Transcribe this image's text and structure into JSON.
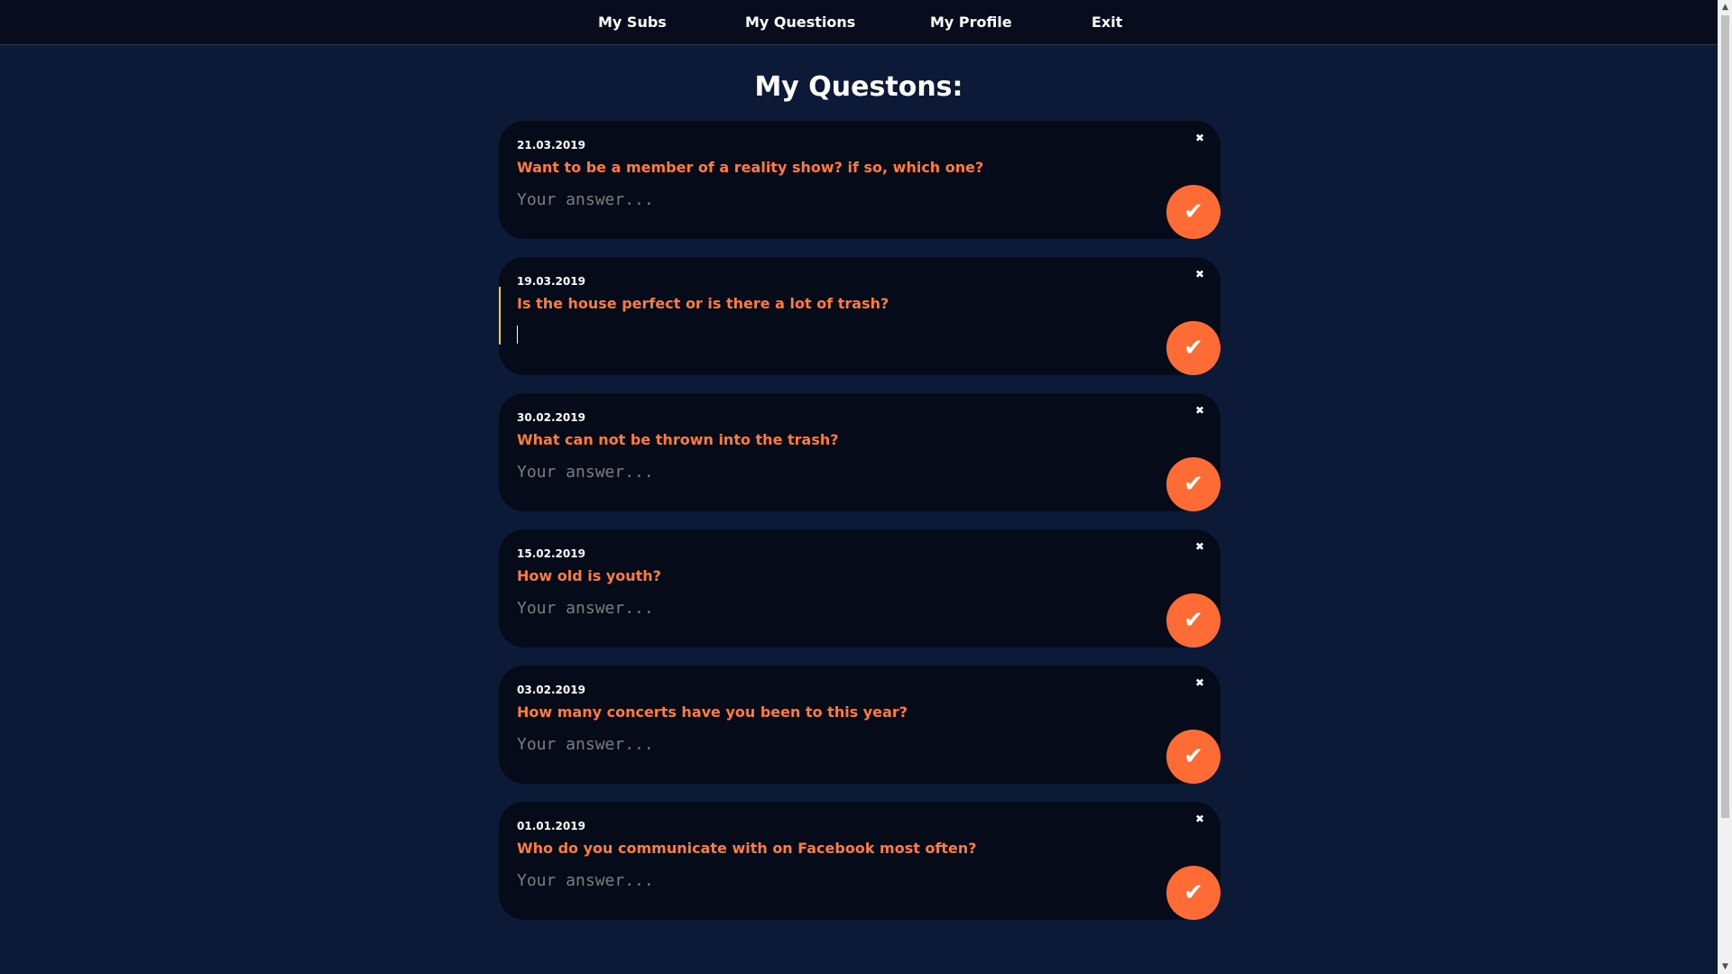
{
  "nav": {
    "items": [
      {
        "label": "My Subs"
      },
      {
        "label": "My Questions"
      },
      {
        "label": "My Profile"
      },
      {
        "label": "Exit"
      }
    ]
  },
  "page": {
    "title": "My Questons:"
  },
  "answer_placeholder": "Your answer...",
  "icons": {
    "close": "close-icon",
    "submit": "checkmark-icon"
  },
  "colors": {
    "background": "#0c1a37",
    "card": "#050b18",
    "accent": "#ff6b35",
    "question_text": "#ff7a3d",
    "focus_indicator": "#f3d21c"
  },
  "questions": [
    {
      "date": "21.03.2019",
      "question": "Want to be a member of a reality show? if so, which one?",
      "answer": "",
      "focused": false
    },
    {
      "date": "19.03.2019",
      "question": "Is the house perfect or is there a lot of trash?",
      "answer": "",
      "focused": true
    },
    {
      "date": "30.02.2019",
      "question": "What can not be thrown into the trash?",
      "answer": "",
      "focused": false
    },
    {
      "date": "15.02.2019",
      "question": "How old is youth?",
      "answer": "",
      "focused": false
    },
    {
      "date": "03.02.2019",
      "question": "How many concerts have you been to this year?",
      "answer": "",
      "focused": false
    },
    {
      "date": "01.01.2019",
      "question": "Who do you communicate with on Facebook most often?",
      "answer": "",
      "focused": false
    }
  ]
}
